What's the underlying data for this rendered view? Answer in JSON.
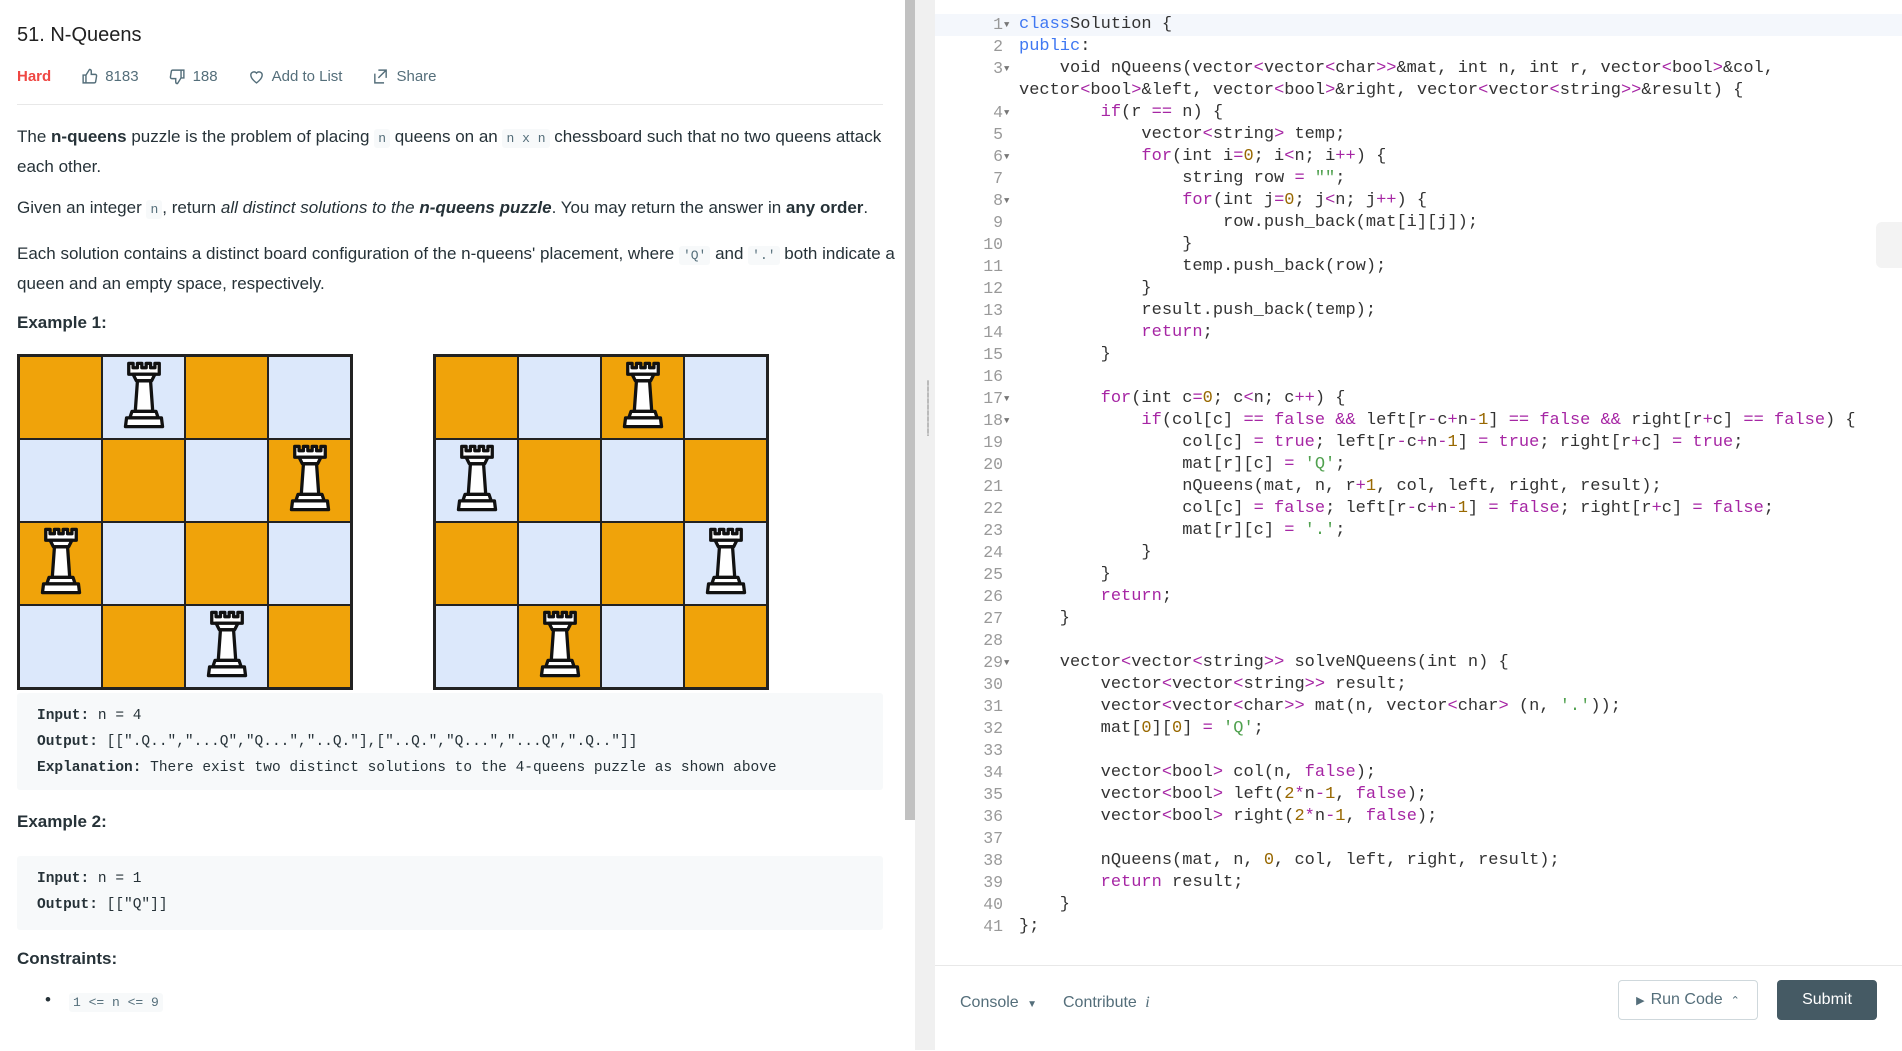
{
  "problem": {
    "title": "51. N-Queens",
    "difficulty": "Hard",
    "likes": "8183",
    "dislikes": "188",
    "add_to_list": "Add to List",
    "share": "Share"
  },
  "description": {
    "p1": {
      "a": "The ",
      "b": "n-queens",
      "c": " puzzle is the problem of placing ",
      "code1": "n",
      "d": " queens on an ",
      "code2": "n x n",
      "e": " chessboard such that no two queens attack each other."
    },
    "p2": {
      "a": "Given an integer ",
      "code1": "n",
      "b": ", return ",
      "c": "all distinct solutions to the ",
      "d": "n-queens puzzle",
      "e": ". You may return the answer in ",
      "f": "any order",
      "g": "."
    },
    "p3": {
      "a": "Each solution contains a distinct board configuration of the n-queens' placement, where ",
      "code1": "'Q'",
      "b": " and ",
      "code2": "'.'",
      "c": " both indicate a queen and an empty space, respectively."
    }
  },
  "example1": {
    "heading": "Example 1:",
    "boards": [
      {
        "queens": [
          1,
          3,
          0,
          2
        ]
      },
      {
        "queens": [
          2,
          0,
          3,
          1
        ]
      }
    ],
    "input_label": "Input:",
    "input": " n = 4",
    "output_label": "Output:",
    "output": " [[\".Q..\",\"...Q\",\"Q...\",\"..Q.\"],[\"..Q.\",\"Q...\",\"...Q\",\".Q..\"]]",
    "explanation_label": "Explanation:",
    "explanation": " There exist two distinct solutions to the 4-queens puzzle as shown above"
  },
  "example2": {
    "heading": "Example 2:",
    "input_label": "Input:",
    "input": " n = 1",
    "output_label": "Output:",
    "output": " [[\"Q\"]]"
  },
  "constraints": {
    "heading": "Constraints:",
    "items": [
      "1 <= n <= 9"
    ]
  },
  "code": [
    {
      "n": "1",
      "f": true,
      "h": [
        [
          "ty",
          "class"
        ],
        [
          "",
          "Solution "
        ],
        [
          "",
          "{"
        ]
      ]
    },
    {
      "n": "2",
      "f": false,
      "h": [
        [
          "ty",
          "public"
        ],
        [
          "",
          ":"
        ]
      ]
    },
    {
      "n": "3",
      "f": true,
      "h": [
        [
          "",
          "    void nQueens(vector"
        ],
        [
          "kw",
          "<"
        ],
        [
          "",
          "vector"
        ],
        [
          "kw",
          "<"
        ],
        [
          "",
          "char"
        ],
        [
          "kw",
          ">>"
        ],
        [
          "",
          ""
        ],
        [
          "",
          "&mat, int n, int r, vector"
        ],
        [
          "kw",
          "<"
        ],
        [
          "",
          "bool"
        ],
        [
          "kw",
          ">"
        ],
        [
          "",
          ""
        ],
        [
          "",
          "&col,"
        ]
      ]
    },
    {
      "n": "",
      "f": false,
      "h": [
        [
          "",
          "vector"
        ],
        [
          "kw",
          "<"
        ],
        [
          "",
          "bool"
        ],
        [
          "kw",
          ">"
        ],
        [
          "",
          ""
        ],
        [
          "",
          "&left, vector"
        ],
        [
          "kw",
          "<"
        ],
        [
          "",
          "bool"
        ],
        [
          "kw",
          ">"
        ],
        [
          "",
          ""
        ],
        [
          "",
          "&right, vector"
        ],
        [
          "kw",
          "<"
        ],
        [
          "",
          "vector"
        ],
        [
          "kw",
          "<"
        ],
        [
          "",
          "string"
        ],
        [
          "kw",
          ">>"
        ],
        [
          "",
          ""
        ],
        [
          "",
          "&result) {"
        ]
      ]
    },
    {
      "n": "4",
      "f": true,
      "h": [
        [
          "",
          "        "
        ],
        [
          "kw",
          "if"
        ],
        [
          "",
          "(r "
        ],
        [
          "kw",
          "=="
        ],
        [
          "",
          ""
        ],
        [
          "",
          " n) {"
        ]
      ]
    },
    {
      "n": "5",
      "f": false,
      "h": [
        [
          "",
          "            vector"
        ],
        [
          "kw",
          "<"
        ],
        [
          "",
          "string"
        ],
        [
          "kw",
          ">"
        ],
        [
          "",
          " temp;"
        ]
      ]
    },
    {
      "n": "6",
      "f": true,
      "h": [
        [
          "",
          "            "
        ],
        [
          "kw",
          "for"
        ],
        [
          "",
          "(int i"
        ],
        [
          "kw",
          "="
        ],
        [
          "nu",
          "0"
        ],
        [
          "",
          "; i"
        ],
        [
          "kw",
          "<"
        ],
        [
          "",
          "n; i"
        ],
        [
          "kw",
          "++"
        ],
        [
          "",
          ") {"
        ]
      ]
    },
    {
      "n": "7",
      "f": false,
      "h": [
        [
          "",
          "                string row "
        ],
        [
          "kw",
          "="
        ],
        [
          "",
          " "
        ],
        [
          "st",
          "\"\""
        ],
        [
          "",
          ";"
        ]
      ]
    },
    {
      "n": "8",
      "f": true,
      "h": [
        [
          "",
          "                "
        ],
        [
          "kw",
          "for"
        ],
        [
          "",
          "(int j"
        ],
        [
          "kw",
          "="
        ],
        [
          "nu",
          "0"
        ],
        [
          "",
          "; j"
        ],
        [
          "kw",
          "<"
        ],
        [
          "",
          "n; j"
        ],
        [
          "kw",
          "++"
        ],
        [
          "",
          ") {"
        ]
      ]
    },
    {
      "n": "9",
      "f": false,
      "h": [
        [
          "",
          "                    row.push_back(mat[i][j]);"
        ]
      ]
    },
    {
      "n": "10",
      "f": false,
      "h": [
        [
          "",
          "                }"
        ]
      ]
    },
    {
      "n": "11",
      "f": false,
      "h": [
        [
          "",
          "                temp.push_back(row);"
        ]
      ]
    },
    {
      "n": "12",
      "f": false,
      "h": [
        [
          "",
          "            }"
        ]
      ]
    },
    {
      "n": "13",
      "f": false,
      "h": [
        [
          "",
          "            result.push_back(temp);"
        ]
      ]
    },
    {
      "n": "14",
      "f": false,
      "h": [
        [
          "",
          "            "
        ],
        [
          "kw",
          "return"
        ],
        [
          "",
          ";"
        ]
      ]
    },
    {
      "n": "15",
      "f": false,
      "h": [
        [
          "",
          "        }"
        ]
      ]
    },
    {
      "n": "16",
      "f": false,
      "h": [
        [
          "",
          ""
        ]
      ]
    },
    {
      "n": "17",
      "f": true,
      "h": [
        [
          "",
          "        "
        ],
        [
          "kw",
          "for"
        ],
        [
          "",
          "(int c"
        ],
        [
          "kw",
          "="
        ],
        [
          "nu",
          "0"
        ],
        [
          "",
          "; c"
        ],
        [
          "kw",
          "<"
        ],
        [
          "",
          "n; c"
        ],
        [
          "kw",
          "++"
        ],
        [
          "",
          ") {"
        ]
      ]
    },
    {
      "n": "18",
      "f": true,
      "h": [
        [
          "",
          "            "
        ],
        [
          "kw",
          "if"
        ],
        [
          "",
          "(col[c] "
        ],
        [
          "kw",
          "=="
        ],
        [
          "",
          " "
        ],
        [
          "kw",
          "false"
        ],
        [
          "",
          " "
        ],
        [
          "kw",
          "&&"
        ],
        [
          "",
          ""
        ],
        [
          "",
          " left[r"
        ],
        [
          "kw",
          "-"
        ],
        [
          "",
          "c"
        ],
        [
          "kw",
          "+"
        ],
        [
          "",
          "n"
        ],
        [
          "kw",
          "-"
        ],
        [
          "nu",
          "1"
        ],
        [
          "",
          "] "
        ],
        [
          "kw",
          "=="
        ],
        [
          "",
          " "
        ],
        [
          "kw",
          "false"
        ],
        [
          "",
          " "
        ],
        [
          "kw",
          "&&"
        ],
        [
          "",
          " right[r"
        ],
        [
          "kw",
          "+"
        ],
        [
          "",
          "c] "
        ],
        [
          "kw",
          "=="
        ],
        [
          "",
          " "
        ],
        [
          "kw",
          "false"
        ],
        [
          "",
          ") {"
        ]
      ]
    },
    {
      "n": "19",
      "f": false,
      "h": [
        [
          "",
          "                col[c] "
        ],
        [
          "kw",
          "="
        ],
        [
          "",
          " "
        ],
        [
          "kw",
          "true"
        ],
        [
          "",
          "; left[r"
        ],
        [
          "kw",
          "-"
        ],
        [
          "",
          "c"
        ],
        [
          "kw",
          "+"
        ],
        [
          "",
          "n"
        ],
        [
          "kw",
          "-"
        ],
        [
          "nu",
          "1"
        ],
        [
          "",
          "] "
        ],
        [
          "kw",
          "="
        ],
        [
          "",
          " "
        ],
        [
          "kw",
          "true"
        ],
        [
          "",
          "; right[r"
        ],
        [
          "kw",
          "+"
        ],
        [
          "",
          "c] "
        ],
        [
          "kw",
          "="
        ],
        [
          "",
          " "
        ],
        [
          "kw",
          "true"
        ],
        [
          "",
          ";"
        ]
      ]
    },
    {
      "n": "20",
      "f": false,
      "h": [
        [
          "",
          "                mat[r][c] "
        ],
        [
          "kw",
          "="
        ],
        [
          "",
          " "
        ],
        [
          "st",
          "'Q'"
        ],
        [
          "",
          ";"
        ]
      ]
    },
    {
      "n": "21",
      "f": false,
      "h": [
        [
          "",
          "                nQueens(mat, n, r"
        ],
        [
          "kw",
          "+"
        ],
        [
          "nu",
          "1"
        ],
        [
          "",
          ", col, left, right, result);"
        ]
      ]
    },
    {
      "n": "22",
      "f": false,
      "h": [
        [
          "",
          "                col[c] "
        ],
        [
          "kw",
          "="
        ],
        [
          "",
          " "
        ],
        [
          "kw",
          "false"
        ],
        [
          "",
          "; left[r"
        ],
        [
          "kw",
          "-"
        ],
        [
          "",
          "c"
        ],
        [
          "kw",
          "+"
        ],
        [
          "",
          "n"
        ],
        [
          "kw",
          "-"
        ],
        [
          "nu",
          "1"
        ],
        [
          "",
          "] "
        ],
        [
          "kw",
          "="
        ],
        [
          "",
          " "
        ],
        [
          "kw",
          "false"
        ],
        [
          "",
          "; right[r"
        ],
        [
          "kw",
          "+"
        ],
        [
          "",
          "c] "
        ],
        [
          "kw",
          "="
        ],
        [
          "",
          " "
        ],
        [
          "kw",
          "false"
        ],
        [
          "",
          ";"
        ]
      ]
    },
    {
      "n": "23",
      "f": false,
      "h": [
        [
          "",
          "                mat[r][c] "
        ],
        [
          "kw",
          "="
        ],
        [
          "",
          " "
        ],
        [
          "st",
          "'.'"
        ],
        [
          "",
          ";"
        ]
      ]
    },
    {
      "n": "24",
      "f": false,
      "h": [
        [
          "",
          "            }"
        ]
      ]
    },
    {
      "n": "25",
      "f": false,
      "h": [
        [
          "",
          "        }"
        ]
      ]
    },
    {
      "n": "26",
      "f": false,
      "h": [
        [
          "",
          "        "
        ],
        [
          "kw",
          "return"
        ],
        [
          "",
          ";"
        ]
      ]
    },
    {
      "n": "27",
      "f": false,
      "h": [
        [
          "",
          "    }"
        ]
      ]
    },
    {
      "n": "28",
      "f": false,
      "h": [
        [
          "",
          ""
        ]
      ]
    },
    {
      "n": "29",
      "f": true,
      "h": [
        [
          "",
          "    vector"
        ],
        [
          "kw",
          "<"
        ],
        [
          "",
          "vector"
        ],
        [
          "kw",
          "<"
        ],
        [
          "",
          "string"
        ],
        [
          "kw",
          ">>"
        ],
        [
          "",
          " solveNQueens(int n) {"
        ]
      ]
    },
    {
      "n": "30",
      "f": false,
      "h": [
        [
          "",
          "        vector"
        ],
        [
          "kw",
          "<"
        ],
        [
          "",
          "vector"
        ],
        [
          "kw",
          "<"
        ],
        [
          "",
          "string"
        ],
        [
          "kw",
          ">>"
        ],
        [
          "",
          " result;"
        ]
      ]
    },
    {
      "n": "31",
      "f": false,
      "h": [
        [
          "",
          "        vector"
        ],
        [
          "kw",
          "<"
        ],
        [
          "",
          "vector"
        ],
        [
          "kw",
          "<"
        ],
        [
          "",
          "char"
        ],
        [
          "kw",
          ">>"
        ],
        [
          "",
          " mat(n, vector"
        ],
        [
          "kw",
          "<"
        ],
        [
          "",
          "char"
        ],
        [
          "kw",
          ">"
        ],
        [
          "",
          " (n, "
        ],
        [
          "st",
          "'.'"
        ],
        [
          "",
          "));"
        ]
      ]
    },
    {
      "n": "32",
      "f": false,
      "h": [
        [
          "",
          "        mat["
        ],
        [
          "nu",
          "0"
        ],
        [
          "",
          "]["
        ],
        [
          "nu",
          "0"
        ],
        [
          "",
          "] "
        ],
        [
          "kw",
          "="
        ],
        [
          "",
          " "
        ],
        [
          "st",
          "'Q'"
        ],
        [
          "",
          ";"
        ]
      ]
    },
    {
      "n": "33",
      "f": false,
      "h": [
        [
          "",
          ""
        ]
      ]
    },
    {
      "n": "34",
      "f": false,
      "h": [
        [
          "",
          "        vector"
        ],
        [
          "kw",
          "<"
        ],
        [
          "",
          "bool"
        ],
        [
          "kw",
          ">"
        ],
        [
          "",
          " col(n, "
        ],
        [
          "kw",
          "false"
        ],
        [
          "",
          ");"
        ]
      ]
    },
    {
      "n": "35",
      "f": false,
      "h": [
        [
          "",
          "        vector"
        ],
        [
          "kw",
          "<"
        ],
        [
          "",
          "bool"
        ],
        [
          "kw",
          ">"
        ],
        [
          "",
          " left("
        ],
        [
          "nu",
          "2"
        ],
        [
          "kw",
          "*"
        ],
        [
          "",
          "n"
        ],
        [
          "kw",
          "-"
        ],
        [
          "nu",
          "1"
        ],
        [
          "",
          ", "
        ],
        [
          "kw",
          "false"
        ],
        [
          "",
          ");"
        ]
      ]
    },
    {
      "n": "36",
      "f": false,
      "h": [
        [
          "",
          "        vector"
        ],
        [
          "kw",
          "<"
        ],
        [
          "",
          "bool"
        ],
        [
          "kw",
          ">"
        ],
        [
          "",
          " right("
        ],
        [
          "nu",
          "2"
        ],
        [
          "kw",
          "*"
        ],
        [
          "",
          "n"
        ],
        [
          "kw",
          "-"
        ],
        [
          "nu",
          "1"
        ],
        [
          "",
          ", "
        ],
        [
          "kw",
          "false"
        ],
        [
          "",
          ");"
        ]
      ]
    },
    {
      "n": "37",
      "f": false,
      "h": [
        [
          "",
          ""
        ]
      ]
    },
    {
      "n": "38",
      "f": false,
      "h": [
        [
          "",
          "        nQueens(mat, n, "
        ],
        [
          "nu",
          "0"
        ],
        [
          "",
          ", col, left, right, result);"
        ]
      ]
    },
    {
      "n": "39",
      "f": false,
      "h": [
        [
          "",
          "        "
        ],
        [
          "kw",
          "return"
        ],
        [
          "",
          " result;"
        ]
      ]
    },
    {
      "n": "40",
      "f": false,
      "h": [
        [
          "",
          "    }"
        ]
      ]
    },
    {
      "n": "41",
      "f": false,
      "h": [
        [
          "",
          "};"
        ]
      ]
    }
  ],
  "footer": {
    "console": "Console",
    "contribute": "Contribute",
    "run_code": "Run Code",
    "submit": "Submit"
  },
  "colors": {
    "board_dark": "#f0a30a",
    "board_light": "#dce8fb",
    "difficulty_hard": "#ef4743",
    "submit_bg": "#455a64"
  }
}
